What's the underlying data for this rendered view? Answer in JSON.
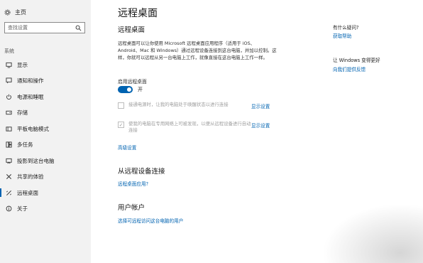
{
  "sidebar": {
    "home_label": "主页",
    "search_placeholder": "查找设置",
    "section_label": "系统",
    "items": [
      {
        "label": "显示",
        "icon": "monitor-icon"
      },
      {
        "label": "通知和操作",
        "icon": "notification-icon"
      },
      {
        "label": "电源和睡眠",
        "icon": "power-icon"
      },
      {
        "label": "存储",
        "icon": "storage-icon"
      },
      {
        "label": "平板电脑模式",
        "icon": "tablet-mode-icon"
      },
      {
        "label": "多任务",
        "icon": "multitask-icon"
      },
      {
        "label": "投影到这台电脑",
        "icon": "project-icon"
      },
      {
        "label": "共享的体验",
        "icon": "shared-experience-icon"
      },
      {
        "label": "远程桌面",
        "icon": "remote-desktop-icon",
        "active": true
      },
      {
        "label": "关于",
        "icon": "info-icon"
      }
    ]
  },
  "main": {
    "title": "远程桌面",
    "section1_title": "远程桌面",
    "description": "远程桌面可以让你使用 Microsoft 远程桌面应用程序（适用于 iOS、Android、Mac 和 Windows）通过远程设备连接到这台电脑，并加以控制。这样，你就可以远程从另一台电脑上工作，就像直接在这台电脑上工作一样。",
    "enable_label": "启用远程桌面",
    "toggle_state": "开",
    "toggle_on": true,
    "option1_text": "接通电源时，让我的电脑处于唤醒状态以进行连接",
    "option1_link": "显示设置",
    "option2_text": "使我的电脑在专用网络上可被发现，以便从远程设备进行自动连接",
    "option2_link": "显示设置",
    "advanced_link": "高级设置",
    "section2_title": "从远程设备连接",
    "section2_link": "远程桌面应用?",
    "section3_title": "用户帐户",
    "section3_link": "选择可远程访问这台电脑的用户"
  },
  "right": {
    "question": "有什么疑问?",
    "help_link": "获取帮助",
    "improve": "让 Windows 变得更好",
    "feedback_link": "向我们提供反馈"
  },
  "colors": {
    "accent": "#0063b1",
    "sidebar_bg": "#f2f2f2",
    "disabled_text": "#9e9e9e"
  }
}
